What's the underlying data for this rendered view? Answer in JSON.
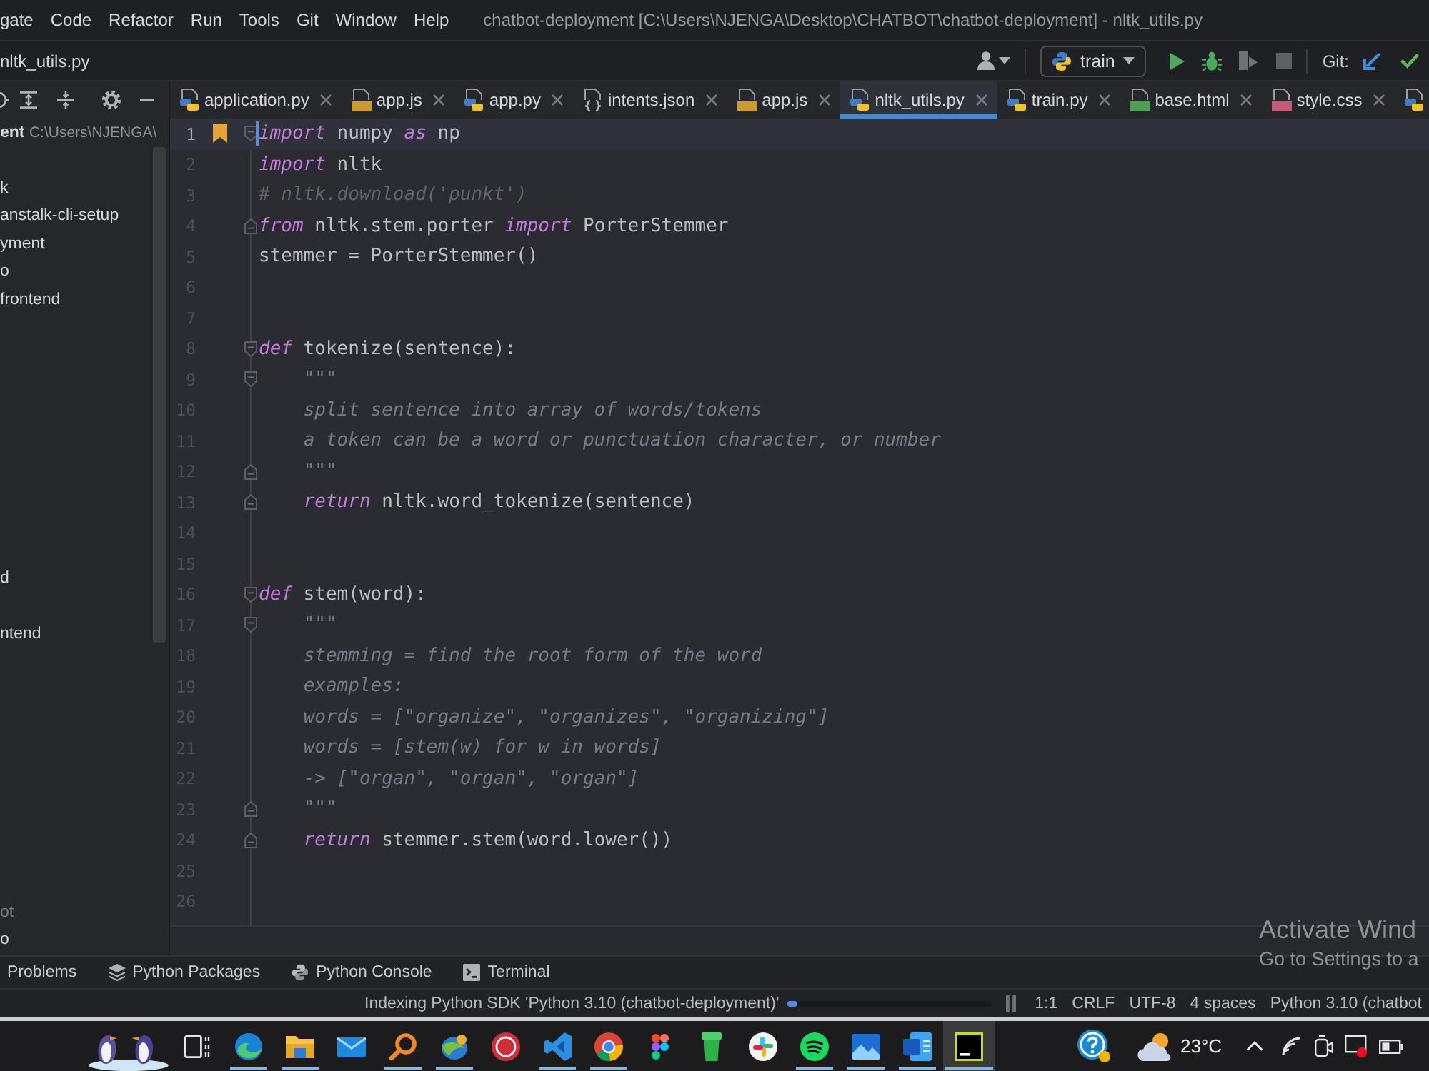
{
  "menu_bar": {
    "items": [
      "gate",
      "Code",
      "Refactor",
      "Run",
      "Tools",
      "Git",
      "Window",
      "Help"
    ],
    "title": "chatbot-deployment [C:\\Users\\NJENGA\\Desktop\\CHATBOT\\chatbot-deployment] - nltk_utils.py"
  },
  "navigation_bar": {
    "breadcrumb": "nltk_utils.py",
    "run_configuration": "train",
    "vcs_label": "Git:"
  },
  "project_panel": {
    "items": [
      {
        "kind": "root",
        "name": "ent",
        "path": "C:\\Users\\NJENGA\\",
        "dimmed": false
      },
      {
        "kind": "item",
        "name": "k",
        "dimmed": false
      },
      {
        "kind": "item",
        "name": "anstalk-cli-setup",
        "dimmed": false
      },
      {
        "kind": "item",
        "name": "yment",
        "dimmed": false
      },
      {
        "kind": "item",
        "name": "o",
        "dimmed": false
      },
      {
        "kind": "item",
        "name": "frontend",
        "dimmed": false
      },
      {
        "kind": "item",
        "name": "d",
        "dimmed": false
      },
      {
        "kind": "item",
        "name": "ntend",
        "dimmed": false
      },
      {
        "kind": "item",
        "name": "ot",
        "dimmed": true
      },
      {
        "kind": "item",
        "name": "o",
        "dimmed": false
      }
    ]
  },
  "editor_tabs": [
    {
      "kind": "python",
      "label": "application.py",
      "selected": false
    },
    {
      "kind": "js",
      "label": "app.js",
      "selected": false
    },
    {
      "kind": "python",
      "label": "app.py",
      "selected": false
    },
    {
      "kind": "json",
      "label": "intents.json",
      "selected": false
    },
    {
      "kind": "js",
      "label": "app.js",
      "selected": false
    },
    {
      "kind": "python",
      "label": "nltk_utils.py",
      "selected": true
    },
    {
      "kind": "python",
      "label": "train.py",
      "selected": false
    },
    {
      "kind": "html",
      "label": "base.html",
      "selected": false
    },
    {
      "kind": "css",
      "label": "style.css",
      "selected": false
    },
    {
      "kind": "python",
      "selected": false
    }
  ],
  "editor": {
    "lines": [
      {
        "number": "1",
        "kind": "fold_start",
        "current": true,
        "bookmarked": true,
        "tokens": [
          {
            "kind": "keyword",
            "text": "import"
          },
          {
            "kind": "plain",
            "text": " numpy "
          },
          {
            "kind": "keyword",
            "text": "as"
          },
          {
            "kind": "plain",
            "text": " np"
          }
        ]
      },
      {
        "number": "2",
        "kind": "plain",
        "current": false,
        "bookmarked": false,
        "tokens": [
          {
            "kind": "keyword",
            "text": "import"
          },
          {
            "kind": "plain",
            "text": " nltk"
          }
        ]
      },
      {
        "number": "3",
        "kind": "plain",
        "current": false,
        "bookmarked": false,
        "tokens": [
          {
            "kind": "comment",
            "text": "# nltk.download('punkt')"
          }
        ]
      },
      {
        "number": "4",
        "kind": "fold_end",
        "current": false,
        "bookmarked": false,
        "tokens": [
          {
            "kind": "keyword",
            "text": "from"
          },
          {
            "kind": "plain",
            "text": " nltk.stem.porter "
          },
          {
            "kind": "keyword",
            "text": "import"
          },
          {
            "kind": "plain",
            "text": " PorterStemmer"
          }
        ]
      },
      {
        "number": "5",
        "kind": "plain",
        "current": false,
        "bookmarked": false,
        "tokens": [
          {
            "kind": "plain",
            "text": "stemmer = PorterStemmer()"
          }
        ]
      },
      {
        "number": "6",
        "kind": "plain",
        "current": false,
        "bookmarked": false
      },
      {
        "number": "7",
        "kind": "plain",
        "current": false,
        "bookmarked": false
      },
      {
        "number": "8",
        "kind": "fold_start",
        "current": false,
        "bookmarked": false,
        "tokens": [
          {
            "kind": "keyword",
            "text": "def"
          },
          {
            "kind": "plain",
            "text": " tokenize(sentence):"
          }
        ]
      },
      {
        "number": "9",
        "kind": "fold_start",
        "current": false,
        "bookmarked": false,
        "tokens": [
          {
            "kind": "docstring",
            "text": "    \"\"\""
          }
        ]
      },
      {
        "number": "10",
        "kind": "plain",
        "current": false,
        "bookmarked": false,
        "tokens": [
          {
            "kind": "docstring",
            "text": "    split sentence into array of words/tokens"
          }
        ]
      },
      {
        "number": "11",
        "kind": "plain",
        "current": false,
        "bookmarked": false,
        "tokens": [
          {
            "kind": "docstring",
            "text": "    a token can be a word or punctuation character, or number"
          }
        ]
      },
      {
        "number": "12",
        "kind": "fold_end",
        "current": false,
        "bookmarked": false,
        "tokens": [
          {
            "kind": "docstring",
            "text": "    \"\"\""
          }
        ]
      },
      {
        "number": "13",
        "kind": "fold_end",
        "current": false,
        "bookmarked": false,
        "tokens": [
          {
            "kind": "keyword",
            "text": "    return"
          },
          {
            "kind": "plain",
            "text": " nltk.word_tokenize(sentence)"
          }
        ]
      },
      {
        "number": "14",
        "kind": "plain",
        "current": false,
        "bookmarked": false
      },
      {
        "number": "15",
        "kind": "plain",
        "current": false,
        "bookmarked": false
      },
      {
        "number": "16",
        "kind": "fold_start",
        "current": false,
        "bookmarked": false,
        "tokens": [
          {
            "kind": "keyword",
            "text": "def"
          },
          {
            "kind": "plain",
            "text": " stem(word):"
          }
        ]
      },
      {
        "number": "17",
        "kind": "fold_start",
        "current": false,
        "bookmarked": false,
        "tokens": [
          {
            "kind": "docstring",
            "text": "    \"\"\""
          }
        ]
      },
      {
        "number": "18",
        "kind": "plain",
        "current": false,
        "bookmarked": false,
        "tokens": [
          {
            "kind": "docstring",
            "text": "    stemming = find the root form of the word"
          }
        ]
      },
      {
        "number": "19",
        "kind": "plain",
        "current": false,
        "bookmarked": false,
        "tokens": [
          {
            "kind": "docstring",
            "text": "    examples:"
          }
        ]
      },
      {
        "number": "20",
        "kind": "plain",
        "current": false,
        "bookmarked": false,
        "tokens": [
          {
            "kind": "docstring",
            "text": "    words = [\"organize\", \"organizes\", \"organizing\"]"
          }
        ]
      },
      {
        "number": "21",
        "kind": "plain",
        "current": false,
        "bookmarked": false,
        "tokens": [
          {
            "kind": "docstring",
            "text": "    words = [stem(w) for w in words]"
          }
        ]
      },
      {
        "number": "22",
        "kind": "plain",
        "current": false,
        "bookmarked": false,
        "tokens": [
          {
            "kind": "docstring",
            "text": "    -> [\"organ\", \"organ\", \"organ\"]"
          }
        ]
      },
      {
        "number": "23",
        "kind": "fold_end",
        "current": false,
        "bookmarked": false,
        "tokens": [
          {
            "kind": "docstring",
            "text": "    \"\"\""
          }
        ]
      },
      {
        "number": "24",
        "kind": "fold_end",
        "current": false,
        "bookmarked": false,
        "tokens": [
          {
            "kind": "keyword",
            "text": "    return"
          },
          {
            "kind": "plain",
            "text": " stemmer.stem(word.lower())"
          }
        ]
      },
      {
        "number": "25",
        "kind": "plain",
        "current": false,
        "bookmarked": false
      },
      {
        "number": "26",
        "kind": "plain",
        "current": false,
        "bookmarked": false
      }
    ]
  },
  "activation_notice": {
    "title": "Activate Wind",
    "text": "Go to Settings to a"
  },
  "tool_window_bar": [
    {
      "kind": "problems",
      "label": "Problems"
    },
    {
      "kind": "packages",
      "label": "Python Packages"
    },
    {
      "kind": "console",
      "label": "Python Console"
    },
    {
      "kind": "terminal",
      "label": "Terminal"
    }
  ],
  "status_bar": {
    "task": "Indexing Python SDK 'Python 3.10 (chatbot-deployment)'",
    "progress": {
      "level": 0.05
    },
    "items": [
      "1:1",
      "CRLF",
      "UTF-8",
      "4 spaces",
      "Python 3.10 (chatbot"
    ]
  },
  "taskbar": {
    "apps": [
      {
        "running": true,
        "selected": false
      },
      {
        "running": true,
        "selected": false
      },
      {
        "running": false,
        "selected": false
      },
      {
        "running": true,
        "selected": false
      },
      {
        "running": true,
        "selected": false
      },
      {
        "running": false,
        "selected": false
      },
      {
        "running": true,
        "selected": false
      },
      {
        "running": true,
        "selected": false
      },
      {
        "running": false,
        "selected": false
      },
      {
        "running": false,
        "selected": false
      },
      {
        "running": false,
        "selected": false
      },
      {
        "running": true,
        "selected": false
      },
      {
        "running": true,
        "selected": false
      },
      {
        "running": true,
        "selected": false
      },
      {
        "running": true,
        "selected": true
      }
    ],
    "temperature": "23°C"
  }
}
